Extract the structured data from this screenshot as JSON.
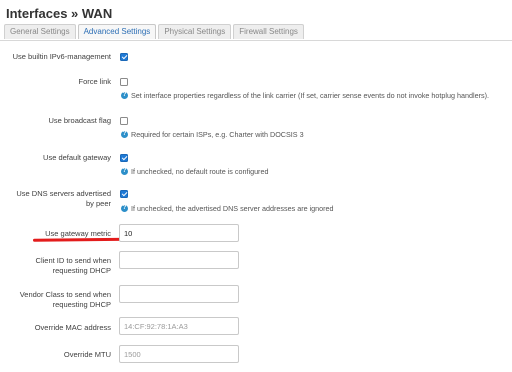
{
  "page": {
    "title": "Interfaces » WAN"
  },
  "tabs": [
    {
      "label": "General Settings",
      "active": false
    },
    {
      "label": "Advanced Settings",
      "active": true
    },
    {
      "label": "Physical Settings",
      "active": false
    },
    {
      "label": "Firewall Settings",
      "active": false
    }
  ],
  "fields": {
    "ipv6_mgmt": {
      "label": "Use builtin IPv6-management",
      "checked": true
    },
    "force_link": {
      "label": "Force link",
      "checked": false,
      "help": "Set interface properties regardless of the link carrier (If set, carrier sense events do not invoke hotplug handlers)."
    },
    "broadcast_flag": {
      "label": "Use broadcast flag",
      "checked": false,
      "help": "Required for certain ISPs, e.g. Charter with DOCSIS 3"
    },
    "default_gateway": {
      "label": "Use default gateway",
      "checked": true,
      "help": "If unchecked, no default route is configured"
    },
    "dns_peer": {
      "label_line1": "Use DNS servers advertised",
      "label_line2": "by peer",
      "checked": true,
      "help": "If unchecked, the advertised DNS server addresses are ignored"
    },
    "gateway_metric": {
      "label": "Use gateway metric",
      "value": "10"
    },
    "client_id": {
      "label_line1": "Client ID to send when",
      "label_line2": "requesting DHCP",
      "value": ""
    },
    "vendor_class": {
      "label_line1": "Vendor Class to send when",
      "label_line2": "requesting DHCP",
      "value": ""
    },
    "mac_address": {
      "label": "Override MAC address",
      "value": "",
      "placeholder": "14:CF:92:78:1A:A3"
    },
    "mtu": {
      "label": "Override MTU",
      "value": "",
      "placeholder": "1500"
    }
  },
  "colors": {
    "accent": "#1f7ad6",
    "annotation_red": "#e31c1c",
    "help_icon": "#2c8fc9"
  },
  "icons": {
    "help": "help-circle-icon",
    "check": "checkmark-icon"
  }
}
